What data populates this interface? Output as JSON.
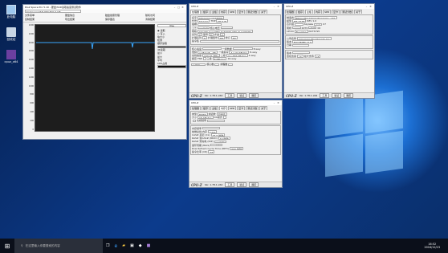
{
  "desktop": {
    "icons": [
      {
        "label": "此电脑"
      },
      {
        "label": "回收站"
      },
      {
        "label": "cpuz_x64"
      }
    ]
  },
  "aida": {
    "title": "Disk Space Pro 5.10 - 硬盘/SSD读取速度测试软件",
    "drive_label": "Samsung SSD 960 500.2 GB",
    "menu": [
      "文件菜单",
      "硬盘信息",
      "磁盘健康管理",
      "随机访问",
      "帮助",
      "关于",
      "复制结果",
      "导出结果",
      "保存图表",
      "清除结果",
      "磁盘基准",
      "退出"
    ],
    "start": "开始",
    "options": [
      "读取",
      "写入",
      "块大小",
      "检测",
      "顺序读取",
      "4K读取",
      "最小",
      "最大",
      "平均",
      "CPU占用"
    ],
    "y_ticks": [
      "2400",
      "2200",
      "2000",
      "1800",
      "1600",
      "1400",
      "1200",
      "1000",
      "800",
      "600",
      "400",
      "200",
      "0"
    ]
  },
  "cpuz1": {
    "title": "CPU-Z",
    "tabs": [
      "处理器",
      "缓存",
      "主板",
      "内存",
      "SPD",
      "显卡",
      "测试分数",
      "关于"
    ],
    "rows": [
      [
        "名字",
        "Intel Core i7 6700K"
      ],
      [
        "代号",
        "Skylake",
        "TDP",
        "95.0 W"
      ],
      [
        "插槽",
        "Socket 1151 LGA"
      ],
      [
        "工艺",
        "14 纳米",
        "核心电压",
        "1.376 V"
      ],
      [
        "规格",
        "Intel(R) Core(TM) i7-6700K CPU @ 4.00GHz"
      ],
      [
        "系列",
        "6",
        "型号",
        "E",
        "步进",
        "3"
      ],
      [
        "扩展系列",
        "6",
        "扩展型号",
        "5E",
        "修订",
        "R0"
      ],
      [
        "指令集",
        "MMX, SSE, SSE2, SSE3, SSSE3, SSE4.1, SSE4.2, EM64T, VT-x, AES, AVX, AVX2, FMA3, TSX"
      ]
    ],
    "clocks": [
      [
        "核心速度",
        "4800.58 MHz",
        "一级数据",
        "4 x 32 KBytes",
        "8-way"
      ],
      [
        "倍频",
        "x 48.0 (8 - 48)",
        "一级指令",
        "4 x 32 KBytes",
        "8-way"
      ],
      [
        "总线速度",
        "100.01 MHz",
        "二级",
        "4 x 256 KBytes",
        "4-way"
      ],
      [
        "额定 FSB",
        "",
        "三级",
        "8 MBytes",
        "16-way"
      ]
    ],
    "sel": "处理器 #1",
    "cores_l": "核心数",
    "cores": "4",
    "threads_l": "线程数",
    "threads": "8",
    "brand": "CPU-Z",
    "ver": "Ver. 1.78.1.x64",
    "tools": "工具",
    "verify": "验证",
    "ok": "确定"
  },
  "cpuz2": {
    "title": "CPU-Z",
    "tabs": [
      "处理器",
      "缓存",
      "主板",
      "内存",
      "SPD",
      "显卡",
      "测试分数",
      "关于"
    ],
    "gen": [
      [
        "类型",
        "DDR4",
        "通道数",
        "双通道"
      ],
      [
        "大小",
        "16 GBytes",
        "DC模式",
        ""
      ],
      [
        "",
        "",
        "北桥频率",
        "4400.3 MHz"
      ]
    ],
    "timing": [
      [
        "内存频率",
        "1597.1 MHz"
      ],
      [
        "前端总线:内存",
        "1:16"
      ],
      [
        "CAS# 延迟 (CL)",
        "15.0 时钟"
      ],
      [
        "RAS# 到CAS# (tRCD)",
        "17 时钟"
      ],
      [
        "RAS# 预充电 (tRP)",
        "17 时钟"
      ],
      [
        "循环周期 (tRAS)",
        "36 时钟"
      ],
      [
        "Row Refresh Cycle Time (tRFC)",
        "560 时钟"
      ],
      [
        "指令比率 (CR)",
        "2T"
      ]
    ],
    "brand": "CPU-Z",
    "ver": "Ver. 1.78.1.x64",
    "tools": "工具",
    "verify": "验证",
    "ok": "确定"
  },
  "cpuz3": {
    "title": "CPU-Z",
    "tabs": [
      "处理器",
      "缓存",
      "主板",
      "内存",
      "SPD",
      "显卡",
      "测试分数",
      "关于"
    ],
    "mb": [
      [
        "制造商",
        "Micro-Star International Co., Ltd."
      ],
      [
        "模型",
        "MS-7A78",
        "REV 1.0"
      ],
      [
        "芯片组",
        "Intel",
        "Skylake",
        "修订",
        "07"
      ],
      [
        "南桥",
        "Intel",
        "Z270",
        "修订",
        "00"
      ],
      [
        "LPCIO",
        "Nuvoton",
        "NCT6795"
      ]
    ],
    "bios": [
      [
        "公司名称",
        "American Megatrends Inc."
      ],
      [
        "版本",
        "E7A78IMS.110"
      ],
      [
        "日期",
        "12/14/2016"
      ]
    ],
    "gfx": [
      [
        "版本",
        "PCI-Express"
      ],
      [
        "连接宽度",
        "x4",
        "最大支持",
        "x4"
      ]
    ],
    "brand": "CPU-Z",
    "ver": "Ver. 1.78.1.x64",
    "tools": "工具",
    "verify": "验证",
    "ok": "确定"
  },
  "taskbar": {
    "search": "在这里输入你要搜索的内容",
    "time": "16:52",
    "date": "2016/12/23"
  }
}
